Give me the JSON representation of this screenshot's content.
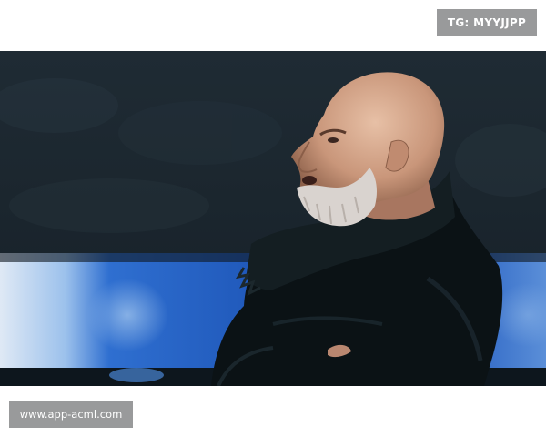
{
  "top_tag": {
    "text": "TG: MYYJJPP"
  },
  "photo": {
    "subject": "bald bearded man in dark coat and scarf in stadium"
  },
  "bottom_tag": {
    "text": "www.app-acml.com"
  }
}
